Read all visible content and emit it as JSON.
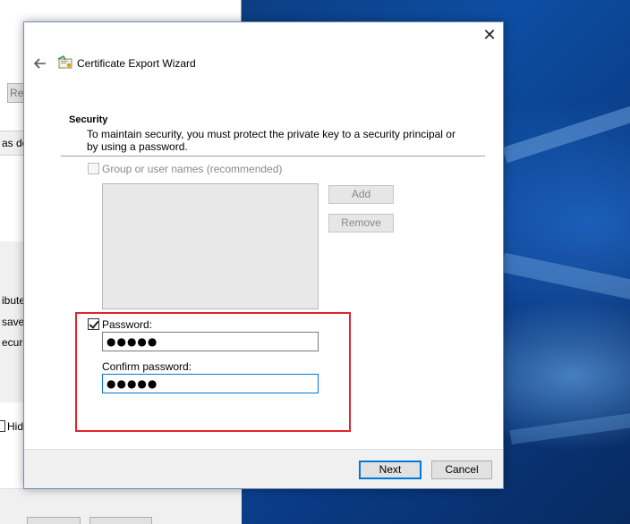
{
  "background_window": {
    "button_partial": "Ren",
    "text_lines": [
      "as de",
      "ibutes",
      " save",
      "ecure"
    ],
    "checkbox_label": "Hidd"
  },
  "dialog": {
    "title": "Certificate Export Wizard",
    "close_glyph": "✕",
    "section": {
      "title": "Security",
      "description": "To maintain security, you must protect the private key to a security principal or by using a password."
    },
    "group_option": {
      "label": "Group or user names (recommended)",
      "checked": false,
      "enabled": false
    },
    "list_buttons": {
      "add": "Add",
      "remove": "Remove"
    },
    "password_option": {
      "label": "Password:",
      "checked": true
    },
    "password_field": {
      "value": "●●●●●"
    },
    "confirm_label": "Confirm password:",
    "confirm_field": {
      "value": "●●●●●"
    },
    "footer": {
      "next": "Next",
      "cancel": "Cancel"
    },
    "highlight_color": "#e0242b",
    "accent_color": "#0078d7"
  }
}
